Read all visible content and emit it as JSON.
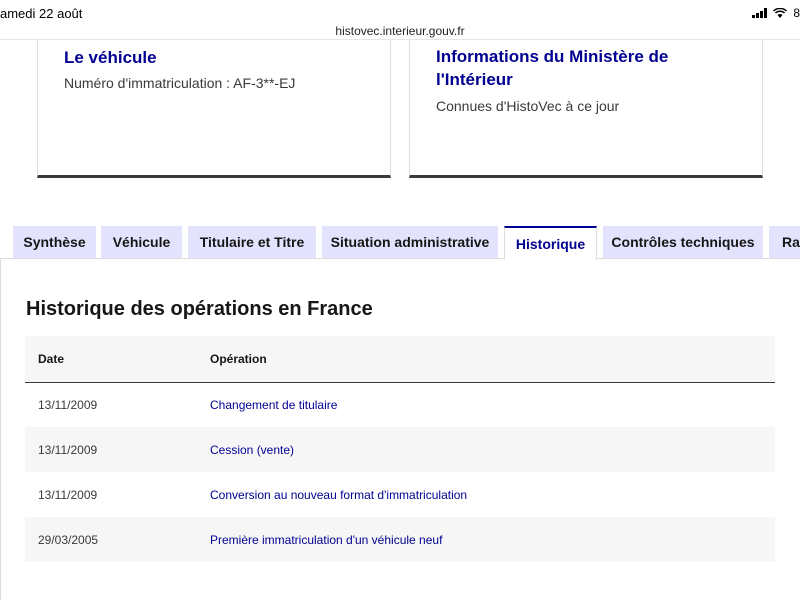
{
  "status_bar": {
    "time": "amedi 22 août",
    "battery": "8",
    "url": "histovec.interieur.gouv.fr"
  },
  "cards": {
    "vehicle": {
      "title": "Le véhicule",
      "description": "Numéro d'immatriculation : AF-3**-EJ"
    },
    "ministry": {
      "title": "Informations du Ministère de l'Intérieur",
      "description": "Connues d'HistoVec à ce jour"
    }
  },
  "tabs": [
    {
      "label": "Synthèse",
      "active": false
    },
    {
      "label": "Véhicule",
      "active": false
    },
    {
      "label": "Titulaire et Titre",
      "active": false
    },
    {
      "label": "Situation administrative",
      "active": false
    },
    {
      "label": "Historique",
      "active": true
    },
    {
      "label": "Contrôles techniques",
      "active": false
    },
    {
      "label": "Rap",
      "active": false
    }
  ],
  "history": {
    "title": "Historique des opérations en France",
    "columns": [
      "Date",
      "Opération"
    ],
    "rows": [
      {
        "date": "13/11/2009",
        "operation": "Changement de titulaire"
      },
      {
        "date": "13/11/2009",
        "operation": "Cession (vente)"
      },
      {
        "date": "13/11/2009",
        "operation": "Conversion au nouveau format d'immatriculation"
      },
      {
        "date": "29/03/2005",
        "operation": "Première immatriculation d'un véhicule neuf"
      }
    ]
  },
  "colors": {
    "accent": "#000091",
    "tab_background": "#e3e3fd",
    "row_alt": "#f6f6f6"
  }
}
